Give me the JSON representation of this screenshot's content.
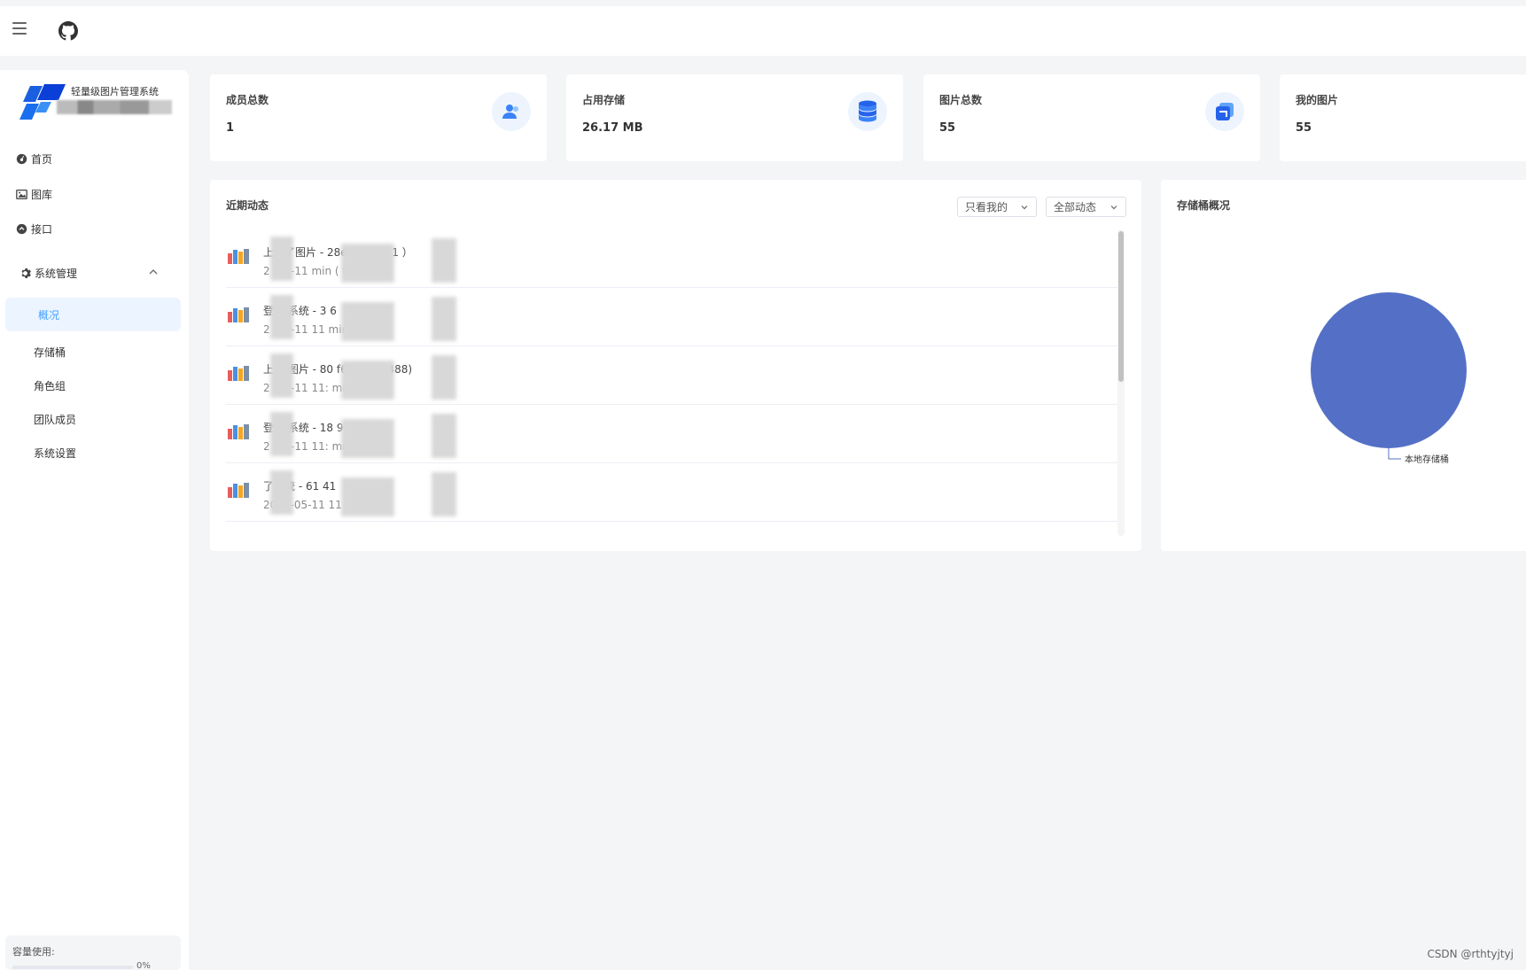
{
  "topbar": {
    "menu_icon": "hamburger-icon",
    "github_icon": "github-icon"
  },
  "sidebar": {
    "logo_title": "轻量级图片管理系统",
    "items": [
      {
        "label": "首页",
        "icon": "dashboard-icon"
      },
      {
        "label": "图库",
        "icon": "image-icon"
      },
      {
        "label": "接口",
        "icon": "api-icon"
      },
      {
        "label": "系统管理",
        "icon": "gear-icon"
      }
    ],
    "sub_items": [
      {
        "label": "概况"
      },
      {
        "label": "存储桶"
      },
      {
        "label": "角色组"
      },
      {
        "label": "团队成员"
      },
      {
        "label": "系统设置"
      }
    ],
    "capacity_label": "容量使用:",
    "capacity_value": "0%"
  },
  "stats": [
    {
      "label": "成员总数",
      "value": "1",
      "icon": "users-icon"
    },
    {
      "label": "占用存储",
      "value": "26.17 MB",
      "icon": "database-icon"
    },
    {
      "label": "图片总数",
      "value": "55",
      "icon": "images-icon"
    },
    {
      "label": "我的图片",
      "value": "55",
      "icon": ""
    }
  ],
  "activity": {
    "title": "近期动态",
    "filter_mine": "只看我的",
    "filter_all": "全部动态",
    "rows": [
      {
        "line1": "上传了图片 - 28ec g （ID:1 ）",
        "line2": "2 -05-11 min ( tc)"
      },
      {
        "line1": "登 了系统 - 3 6 （安 六安",
        "line2": "2 -05-11 11 min ( tc)"
      },
      {
        "line1": "上 了图片 - 80 f65d9 g 1488)",
        "line2": "2 -05-11 11: min ( tc"
      },
      {
        "line1": "登 了系统 - 18 9 （广 市）",
        "line2": "2 -05-11 11: min ("
      },
      {
        "line1": "了系统 - 61 41 （ 郑州市）",
        "line2": "2022-05-11 11 min ( )"
      }
    ]
  },
  "storage": {
    "title": "存储桶概况"
  },
  "chart_data": {
    "type": "pie",
    "title": "",
    "slices": [
      {
        "label": "本地存储桶",
        "value": 100
      }
    ],
    "colors": [
      "#5470c6"
    ]
  },
  "watermark": "CSDN @rthtyjtyj"
}
